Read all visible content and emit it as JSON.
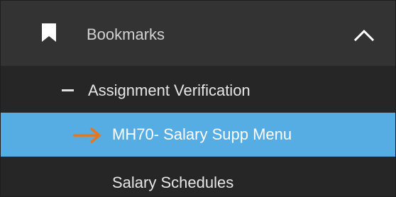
{
  "header": {
    "title": "Bookmarks",
    "icon": "bookmark-icon",
    "toggle_icon": "chevron-up-icon"
  },
  "section": {
    "icon": "minus-icon",
    "label": "Assignment Verification"
  },
  "items": [
    {
      "label": "MH70- Salary Supp Menu",
      "active": true,
      "icon": "arrow-right-icon"
    },
    {
      "label": "Salary Schedules",
      "active": false
    }
  ],
  "colors": {
    "panel_bg": "#2c2c2c",
    "header_bg": "#333333",
    "active_bg": "#55ade3",
    "arrow": "#e8761d"
  }
}
